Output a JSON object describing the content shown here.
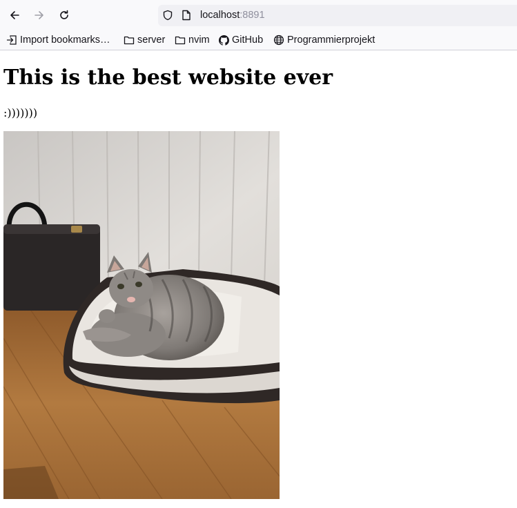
{
  "browser": {
    "url_host": "localhost",
    "url_port": ":8891",
    "bookmarks": [
      {
        "label": "Import bookmarks…",
        "icon": "import-icon"
      },
      {
        "label": "server",
        "icon": "folder-icon"
      },
      {
        "label": "nvim",
        "icon": "folder-icon"
      },
      {
        "label": "GitHub",
        "icon": "github-icon"
      },
      {
        "label": "Programmierprojekt",
        "icon": "globe-icon"
      }
    ]
  },
  "page": {
    "heading": "This is the best website ever",
    "paragraph": ":)))))))",
    "image": {
      "subject": "cat-photo",
      "colors": {
        "wall": "#d9d6d2",
        "floor": "#a36a33",
        "bed": "#2f2826",
        "cushion": "#e9e5e0",
        "cat": "#8c8784"
      }
    }
  }
}
